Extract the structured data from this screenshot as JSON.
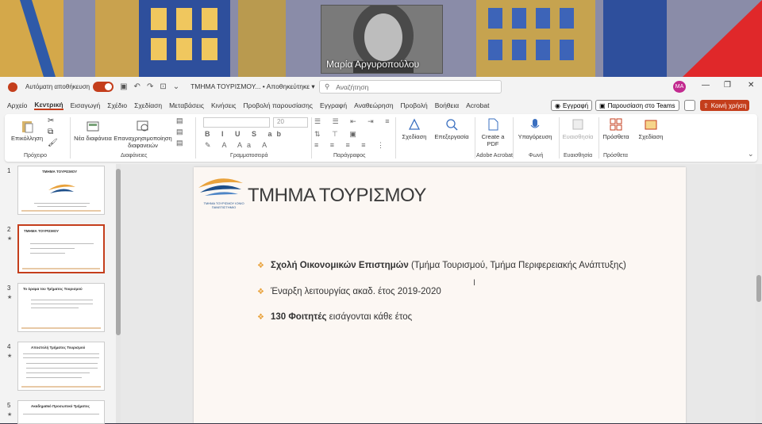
{
  "meeting": {
    "participant_name": "Μαρία Αργυροπούλου",
    "accent_color": "#c43e1c"
  },
  "titlebar": {
    "autosave_label": "Αυτόματη αποθήκευση",
    "toggle_state": "Ενεργό",
    "doc_title": "ΤΜΗΜΑ ΤΟΥΡΙΣΜΟΥ... • Αποθηκεύτηκε ▾",
    "search_placeholder": "Αναζήτηση",
    "avatar_initials": "MA"
  },
  "menu": {
    "tabs": [
      "Αρχείο",
      "Κεντρική",
      "Εισαγωγή",
      "Σχέδιο",
      "Σχεδίαση",
      "Μεταβάσεις",
      "Κινήσεις",
      "Προβολή παρουσίασης",
      "Εγγραφή",
      "Αναθεώρηση",
      "Προβολή",
      "Βοήθεια",
      "Acrobat"
    ],
    "active_tab": "Κεντρική",
    "record_label": "Εγγραφή",
    "teams_label": "Παρουσίαση στο Teams",
    "share_label": "Κοινή χρήση"
  },
  "ribbon": {
    "paste": "Επικόλληση",
    "new_slide": "Νέα διαφάνεια",
    "reuse": "Επαναχρησιμοποίηση διαφανειών",
    "font_size": "20",
    "shapes": "Σχεδίαση",
    "editing": "Επεξεργασία",
    "create_pdf": "Create a PDF",
    "dictate": "Υπαγόρευση",
    "sensitivity": "Ευαισθησία",
    "addins": "Πρόσθετα",
    "designer": "Σχεδίαση",
    "groups": {
      "clipboard": "Πρόχειρο",
      "slides": "Διαφάνειες",
      "font": "Γραμματοσειρά",
      "paragraph": "Παράγραφος",
      "acrobat": "Adobe Acrobat",
      "voice": "Φωνή",
      "sensitivity": "Ευαισθησία",
      "addins": "Πρόσθετα"
    }
  },
  "thumbnails": [
    {
      "num": "1",
      "title": "ΤΜΗΜΑ ΤΟΥΡΙΣΜΟΥ"
    },
    {
      "num": "2",
      "title": "ΤΜΗΜΑ ΤΟΥΡΙΣΜΟΥ"
    },
    {
      "num": "3",
      "title": "Το όραμα του Τμήματος Τουρισμού"
    },
    {
      "num": "4",
      "title": "Αποστολή Τμήματος Τουρισμού"
    },
    {
      "num": "5",
      "title": "Ακαδημαϊκό Προσωπικό Τμήματος"
    }
  ],
  "slide": {
    "title": "ΤΜΗΜΑ ΤΟΥΡΙΣΜΟΥ",
    "logo_caption": "ΤΜΗΜΑ ΤΟΥΡΙΣΜΟΥ ΙΟΝΙΟ ΠΑΝΕΠΙΣΤΗΜΙΟ",
    "bullets": [
      {
        "bold": "Σχολή Οικονομικών Επιστημών",
        "rest": " (Τμήμα Τουρισμού, Τμήμα Περιφερειακής Ανάπτυξης)"
      },
      {
        "bold": "",
        "rest": "Έναρξη λειτουργίας ακαδ. έτος 2019-2020"
      },
      {
        "bold": "130 Φοιτητές",
        "rest": " εισάγονται κάθε έτος"
      }
    ]
  }
}
